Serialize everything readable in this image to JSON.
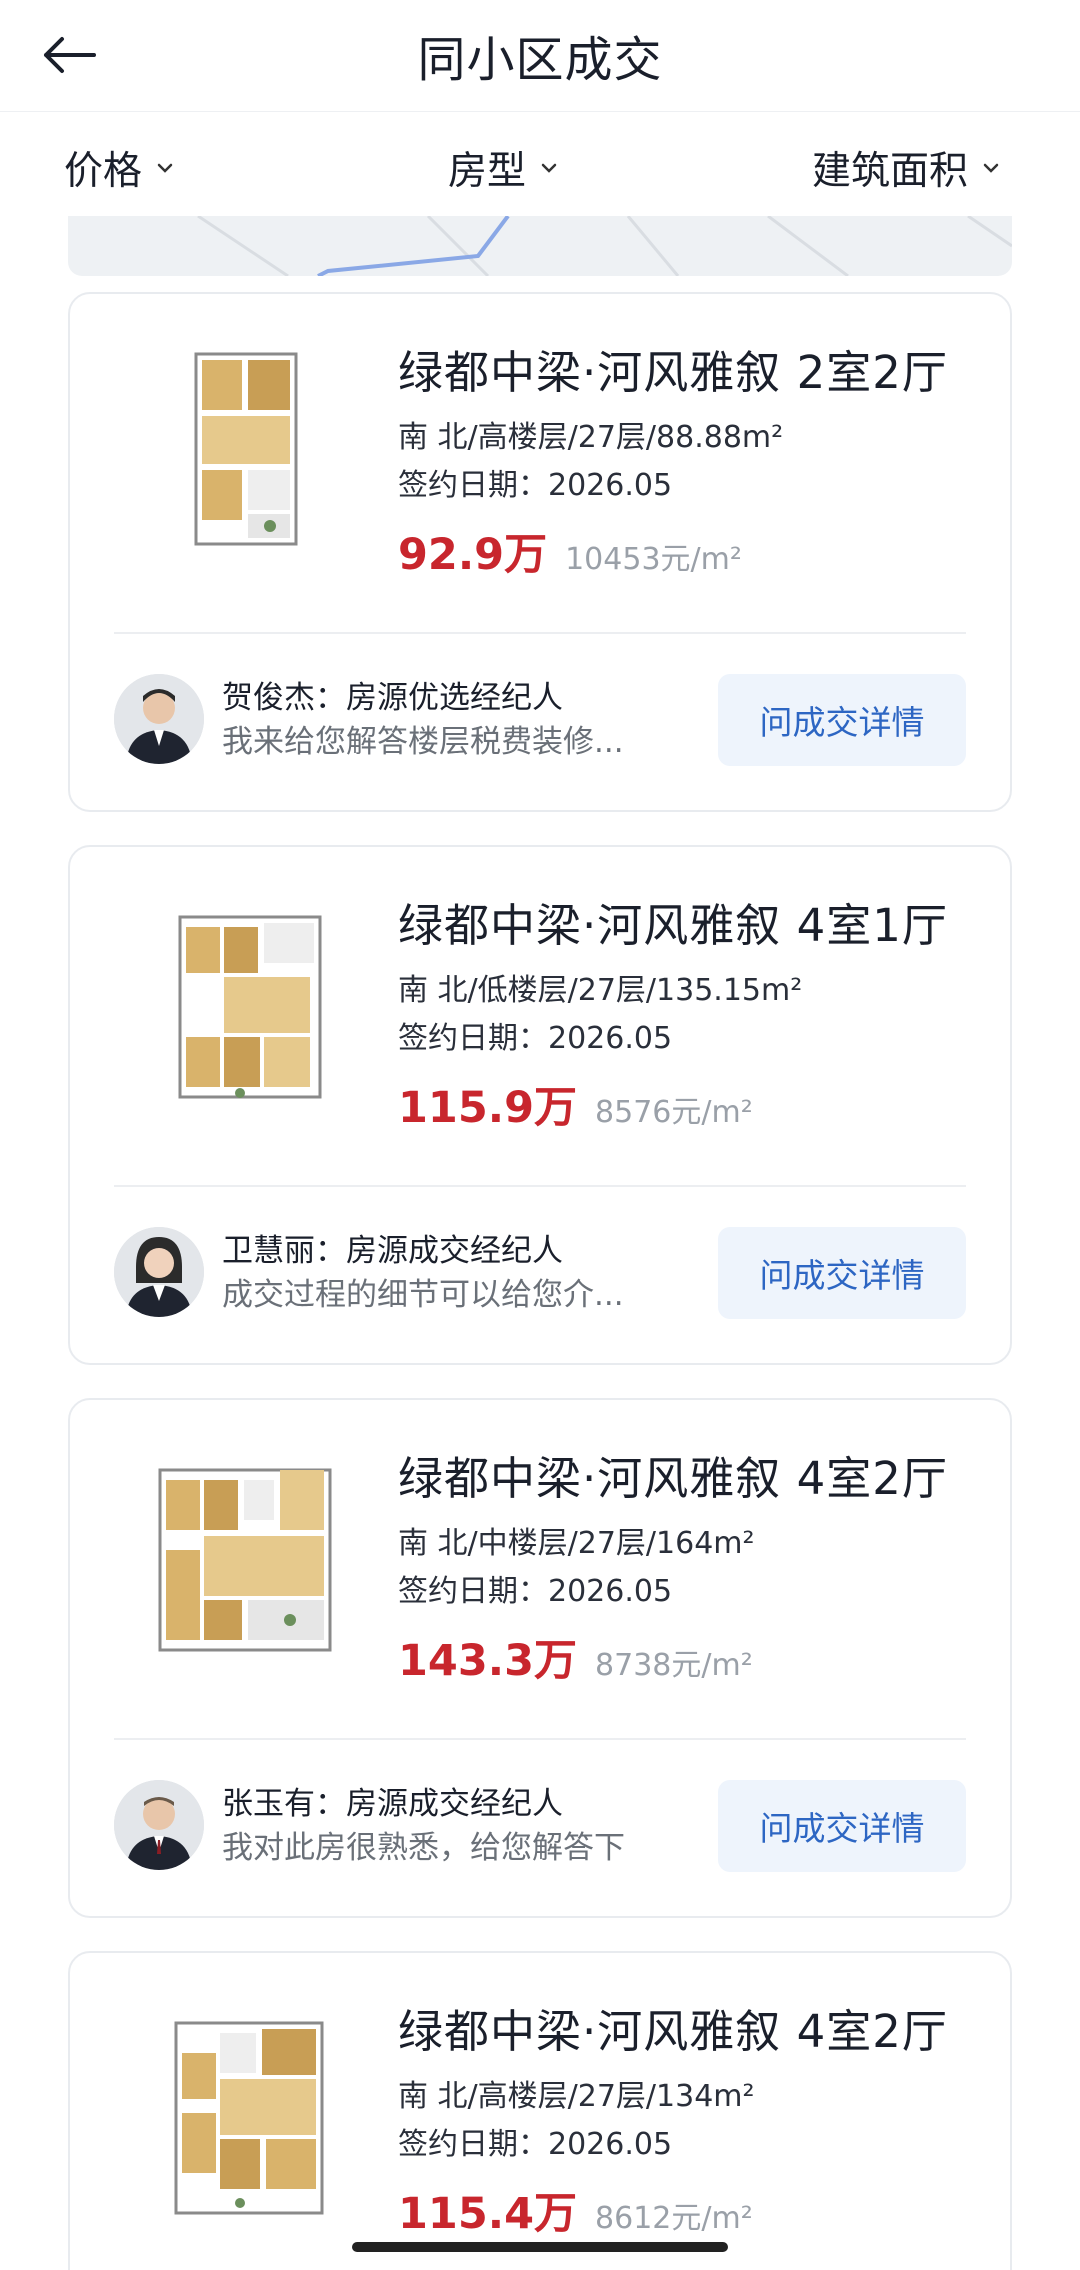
{
  "header": {
    "title": "同小区成交"
  },
  "filters": [
    {
      "label": "价格"
    },
    {
      "label": "房型"
    },
    {
      "label": "建筑面积"
    }
  ],
  "listings": [
    {
      "title": "绿都中梁·河风雅叙 2室2厅",
      "info": "南 北/高楼层/27层/88.88m²",
      "date": "签约日期：2026.05",
      "price": "92.9万",
      "unit_price": "10453元/m²",
      "agent": {
        "name": "贺俊杰：房源优选经纪人",
        "message": "我来给您解答楼层税费装修..."
      },
      "button": "问成交详情"
    },
    {
      "title": "绿都中梁·河风雅叙 4室1厅",
      "info": "南 北/低楼层/27层/135.15m²",
      "date": "签约日期：2026.05",
      "price": "115.9万",
      "unit_price": "8576元/m²",
      "agent": {
        "name": "卫慧丽：房源成交经纪人",
        "message": "成交过程的细节可以给您介..."
      },
      "button": "问成交详情"
    },
    {
      "title": "绿都中梁·河风雅叙 4室2厅",
      "info": "南 北/中楼层/27层/164m²",
      "date": "签约日期：2026.05",
      "price": "143.3万",
      "unit_price": "8738元/m²",
      "agent": {
        "name": "张玉有：房源成交经纪人",
        "message": "我对此房很熟悉，给您解答下"
      },
      "button": "问成交详情"
    },
    {
      "title": "绿都中梁·河风雅叙 4室2厅",
      "info": "南 北/高楼层/27层/134m²",
      "date": "签约日期：2026.05",
      "price": "115.4万",
      "unit_price": "8612元/m²"
    }
  ],
  "colors": {
    "price": "#c8262d",
    "button_text": "#2d66c3",
    "button_bg": "#eef4fc"
  },
  "icons": [
    "back-arrow-icon",
    "chevron-down-icon",
    "floor-plan-image",
    "agent-avatar"
  ]
}
